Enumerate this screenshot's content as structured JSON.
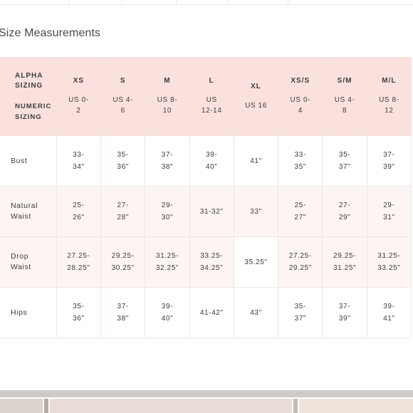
{
  "page": {
    "title": "Size Measurements"
  },
  "table": {
    "header": {
      "alpha_label": "ALPHA SIZING",
      "numeric_label": "NUMERIC SIZING"
    },
    "columns": [
      {
        "alpha": "XS",
        "numeric": "US 0-\n2"
      },
      {
        "alpha": "S",
        "numeric": "US 4-\n6"
      },
      {
        "alpha": "M",
        "numeric": "US 8-\n10"
      },
      {
        "alpha": "L",
        "numeric": "US\n12-14"
      },
      {
        "alpha": "XL",
        "numeric": "US 16"
      },
      {
        "alpha": "XS/S",
        "numeric": "US 0-\n4"
      },
      {
        "alpha": "S/M",
        "numeric": "US 4-\n8"
      },
      {
        "alpha": "M/L",
        "numeric": "US 8-\n12"
      }
    ],
    "rows": [
      {
        "label": "Bust",
        "values": [
          "33-\n34\"",
          "35-\n36\"",
          "37-\n38\"",
          "39-\n40\"",
          "41\"",
          "33-\n35\"",
          "35-\n37\"",
          "37-\n39\""
        ]
      },
      {
        "label": "Natural\nWaist",
        "values": [
          "25-\n26\"",
          "27-\n28\"",
          "29-\n30\"",
          "31-32\"",
          "33\"",
          "25-\n27\"",
          "27-\n29\"",
          "29-\n31\""
        ]
      },
      {
        "label": "Drop\nWaist",
        "values": [
          "27.25-\n28.25\"",
          "29.25-\n30.25\"",
          "31.25-\n32.25\"",
          "33.25-\n34.25\"",
          "35.25\"",
          "27.25-\n29.25\"",
          "29.25-\n31.25\"",
          "31.25-\n33.25\""
        ]
      },
      {
        "label": "Hips",
        "values": [
          "35-\n36\"",
          "37-\n38\"",
          "39-\n40\"",
          "41-42\"",
          "43\"",
          "35-\n37\"",
          "37-\n39\"",
          "39-\n41\""
        ]
      }
    ]
  },
  "colors": {
    "header_background": "#fbe1de",
    "alt_row_background": "#fdf5f3",
    "border": "#eee6e3",
    "text": "#3b3b3b"
  }
}
